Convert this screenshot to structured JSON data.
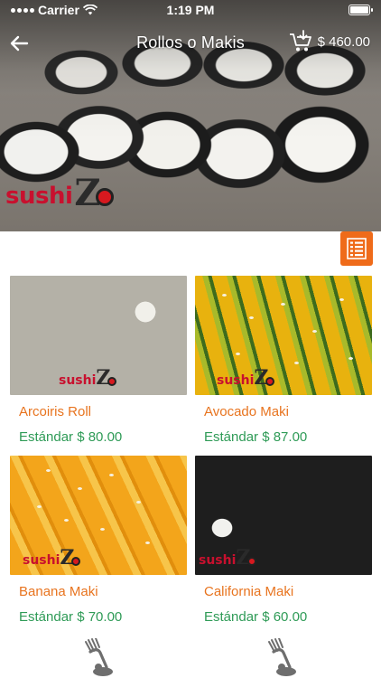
{
  "status_bar": {
    "carrier": "Carrier",
    "time": "1:19 PM"
  },
  "header": {
    "title": "Rollos o Makis",
    "cart_total": "$ 460.00",
    "logo_text": "sushiZo"
  },
  "products": [
    {
      "name": "Arcoiris Roll",
      "price": "Estándar $ 80.00"
    },
    {
      "name": "Avocado Maki",
      "price": "Estándar $ 87.00"
    },
    {
      "name": "Banana Maki",
      "price": "Estándar $ 70.00"
    },
    {
      "name": "California Maki",
      "price": "Estándar $ 60.00"
    }
  ],
  "icons": {
    "back": "arrow-left-icon",
    "cart": "cart-download-icon",
    "view_toggle": "list-view-icon",
    "footer": "fork-chef-icon"
  },
  "colors": {
    "accent_orange": "#ef6b1a",
    "product_name": "#e8741f",
    "price_green": "#2f9b57",
    "brand_red": "#c8102e"
  }
}
